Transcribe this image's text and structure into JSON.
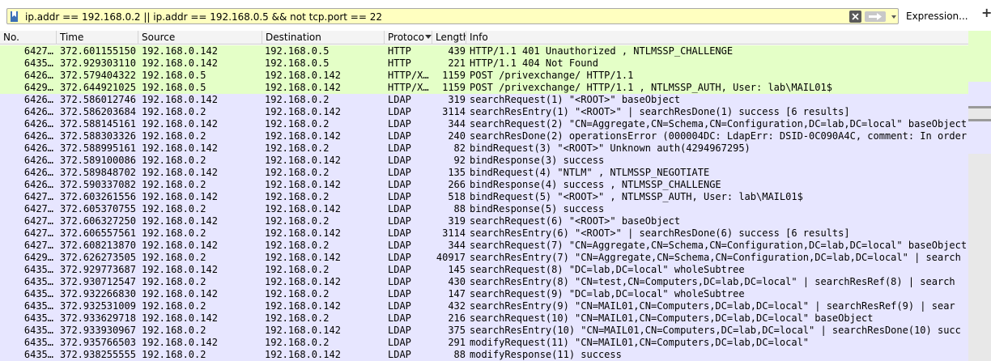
{
  "filter": {
    "value": "ip.addr == 192.168.0.2 || ip.addr == 192.168.0.5 && not tcp.port == 22",
    "expression_label": "Expression...",
    "plus_label": "+"
  },
  "columns": {
    "no": "No.",
    "time": "Time",
    "source": "Source",
    "destination": "Destination",
    "protocol": "Protoco",
    "length": "Length",
    "info": "Info"
  },
  "colors": {
    "http_row": "#e4ffc7",
    "ldap_row": "#e7e6ff",
    "filter_bg": "#ffffc0"
  },
  "rows": [
    {
      "type": "http",
      "no": "6427…",
      "time": "372.601155150",
      "src": "192.168.0.142",
      "dst": "192.168.0.5",
      "proto": "HTTP",
      "len": "439",
      "info": "HTTP/1.1 401 Unauthorized , NTLMSSP_CHALLENGE"
    },
    {
      "type": "http",
      "no": "6435…",
      "time": "372.929303110",
      "src": "192.168.0.142",
      "dst": "192.168.0.5",
      "proto": "HTTP",
      "len": "221",
      "info": "HTTP/1.1 404 Not Found"
    },
    {
      "type": "http",
      "no": "6426…",
      "time": "372.579404322",
      "src": "192.168.0.5",
      "dst": "192.168.0.142",
      "proto": "HTTP/X…",
      "len": "1159",
      "info": "POST /privexchange/ HTTP/1.1"
    },
    {
      "type": "http",
      "no": "6429…",
      "time": "372.644921025",
      "src": "192.168.0.5",
      "dst": "192.168.0.142",
      "proto": "HTTP/X…",
      "len": "1159",
      "info": "POST /privexchange/ HTTP/1.1 , NTLMSSP_AUTH, User: lab\\MAIL01$"
    },
    {
      "type": "ldap",
      "no": "6426…",
      "time": "372.586012746",
      "src": "192.168.0.142",
      "dst": "192.168.0.2",
      "proto": "LDAP",
      "len": "319",
      "info": "searchRequest(1) \"<ROOT>\" baseObject"
    },
    {
      "type": "ldap",
      "no": "6426…",
      "time": "372.586203684",
      "src": "192.168.0.2",
      "dst": "192.168.0.142",
      "proto": "LDAP",
      "len": "3114",
      "info": "searchResEntry(1) \"<ROOT>\"  | searchResDone(1) success  [6 results]"
    },
    {
      "type": "ldap",
      "no": "6426…",
      "time": "372.588145161",
      "src": "192.168.0.142",
      "dst": "192.168.0.2",
      "proto": "LDAP",
      "len": "344",
      "info": "searchRequest(2) \"CN=Aggregate,CN=Schema,CN=Configuration,DC=lab,DC=local\" baseObject"
    },
    {
      "type": "ldap",
      "no": "6426…",
      "time": "372.588303326",
      "src": "192.168.0.2",
      "dst": "192.168.0.142",
      "proto": "LDAP",
      "len": "240",
      "info": "searchResDone(2) operationsError (000004DC: LdapErr: DSID-0C090A4C, comment: In order"
    },
    {
      "type": "ldap",
      "no": "6426…",
      "time": "372.588995161",
      "src": "192.168.0.142",
      "dst": "192.168.0.2",
      "proto": "LDAP",
      "len": "82",
      "info": "bindRequest(3) \"<ROOT>\" Unknown auth(4294967295)"
    },
    {
      "type": "ldap",
      "no": "6426…",
      "time": "372.589100086",
      "src": "192.168.0.2",
      "dst": "192.168.0.142",
      "proto": "LDAP",
      "len": "92",
      "info": "bindResponse(3) success"
    },
    {
      "type": "ldap",
      "no": "6426…",
      "time": "372.589848702",
      "src": "192.168.0.142",
      "dst": "192.168.0.2",
      "proto": "LDAP",
      "len": "135",
      "info": "bindRequest(4) \"NTLM\" , NTLMSSP_NEGOTIATE"
    },
    {
      "type": "ldap",
      "no": "6426…",
      "time": "372.590337082",
      "src": "192.168.0.2",
      "dst": "192.168.0.142",
      "proto": "LDAP",
      "len": "266",
      "info": "bindResponse(4) success , NTLMSSP_CHALLENGE"
    },
    {
      "type": "ldap",
      "no": "6427…",
      "time": "372.603261556",
      "src": "192.168.0.142",
      "dst": "192.168.0.2",
      "proto": "LDAP",
      "len": "518",
      "info": "bindRequest(5) \"<ROOT>\" , NTLMSSP_AUTH, User: lab\\MAIL01$"
    },
    {
      "type": "ldap",
      "no": "6427…",
      "time": "372.605370755",
      "src": "192.168.0.2",
      "dst": "192.168.0.142",
      "proto": "LDAP",
      "len": "88",
      "info": "bindResponse(5) success"
    },
    {
      "type": "ldap",
      "no": "6427…",
      "time": "372.606327250",
      "src": "192.168.0.142",
      "dst": "192.168.0.2",
      "proto": "LDAP",
      "len": "319",
      "info": "searchRequest(6) \"<ROOT>\" baseObject"
    },
    {
      "type": "ldap",
      "no": "6427…",
      "time": "372.606557561",
      "src": "192.168.0.2",
      "dst": "192.168.0.142",
      "proto": "LDAP",
      "len": "3114",
      "info": "searchResEntry(6) \"<ROOT>\"  | searchResDone(6) success  [6 results]"
    },
    {
      "type": "ldap",
      "no": "6427…",
      "time": "372.608213870",
      "src": "192.168.0.142",
      "dst": "192.168.0.2",
      "proto": "LDAP",
      "len": "344",
      "info": "searchRequest(7) \"CN=Aggregate,CN=Schema,CN=Configuration,DC=lab,DC=local\" baseObject"
    },
    {
      "type": "ldap",
      "no": "6429…",
      "time": "372.626273505",
      "src": "192.168.0.2",
      "dst": "192.168.0.142",
      "proto": "LDAP",
      "len": "40917",
      "info": "searchResEntry(7) \"CN=Aggregate,CN=Schema,CN=Configuration,DC=lab,DC=local\"  | search"
    },
    {
      "type": "ldap",
      "no": "6435…",
      "time": "372.929773687",
      "src": "192.168.0.142",
      "dst": "192.168.0.2",
      "proto": "LDAP",
      "len": "145",
      "info": "searchRequest(8) \"DC=lab,DC=local\" wholeSubtree"
    },
    {
      "type": "ldap",
      "no": "6435…",
      "time": "372.930712547",
      "src": "192.168.0.2",
      "dst": "192.168.0.142",
      "proto": "LDAP",
      "len": "430",
      "info": "searchResEntry(8) \"CN=test,CN=Computers,DC=lab,DC=local\"  | searchResRef(8)  | search"
    },
    {
      "type": "ldap",
      "no": "6435…",
      "time": "372.932266830",
      "src": "192.168.0.142",
      "dst": "192.168.0.2",
      "proto": "LDAP",
      "len": "147",
      "info": "searchRequest(9) \"DC=lab,DC=local\" wholeSubtree"
    },
    {
      "type": "ldap",
      "no": "6435…",
      "time": "372.932531009",
      "src": "192.168.0.2",
      "dst": "192.168.0.142",
      "proto": "LDAP",
      "len": "432",
      "info": "searchResEntry(9) \"CN=MAIL01,CN=Computers,DC=lab,DC=local\"  | searchResRef(9)  | sear"
    },
    {
      "type": "ldap",
      "no": "6435…",
      "time": "372.933629718",
      "src": "192.168.0.142",
      "dst": "192.168.0.2",
      "proto": "LDAP",
      "len": "216",
      "info": "searchRequest(10) \"CN=MAIL01,CN=Computers,DC=lab,DC=local\" baseObject"
    },
    {
      "type": "ldap",
      "no": "6435…",
      "time": "372.933930967",
      "src": "192.168.0.2",
      "dst": "192.168.0.142",
      "proto": "LDAP",
      "len": "375",
      "info": "searchResEntry(10) \"CN=MAIL01,CN=Computers,DC=lab,DC=local\"  | searchResDone(10) succ"
    },
    {
      "type": "ldap",
      "no": "6435…",
      "time": "372.935766503",
      "src": "192.168.0.142",
      "dst": "192.168.0.2",
      "proto": "LDAP",
      "len": "291",
      "info": "modifyRequest(11) \"CN=MAIL01,CN=Computers,DC=lab,DC=local\""
    },
    {
      "type": "ldap",
      "no": "6435…",
      "time": "372.938255555",
      "src": "192.168.0.2",
      "dst": "192.168.0.142",
      "proto": "LDAP",
      "len": "88",
      "info": "modifyResponse(11) success"
    }
  ]
}
